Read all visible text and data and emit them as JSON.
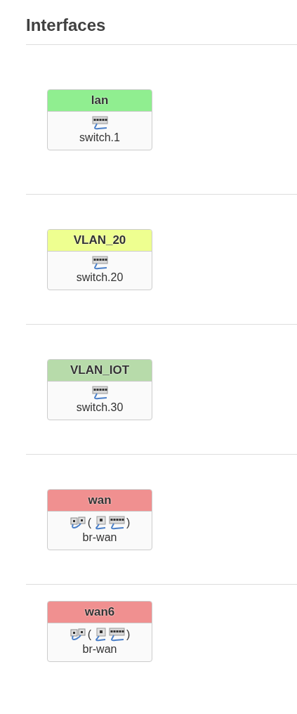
{
  "title": "Interfaces",
  "interfaces": [
    {
      "name": "lan",
      "color": "#90ee90",
      "device": {
        "kind": "switch"
      },
      "device_name": "switch.1"
    },
    {
      "name": "VLAN_20",
      "color": "#eeff90",
      "device": {
        "kind": "switch"
      },
      "device_name": "switch.20"
    },
    {
      "name": "VLAN_IOT",
      "color": "#b7dbaa",
      "device": {
        "kind": "switch"
      },
      "device_name": "switch.30"
    },
    {
      "name": "wan",
      "color": "#f09090",
      "device": {
        "kind": "bridge",
        "open": "(",
        "members": [
          {
            "kind": "port"
          },
          {
            "kind": "switch"
          }
        ],
        "close": ")"
      },
      "device_name": "br-wan"
    },
    {
      "name": "wan6",
      "color": "#f09090",
      "device": {
        "kind": "bridge",
        "open": "(",
        "members": [
          {
            "kind": "port"
          },
          {
            "kind": "switch"
          }
        ],
        "close": ")"
      },
      "device_name": "br-wan"
    }
  ]
}
